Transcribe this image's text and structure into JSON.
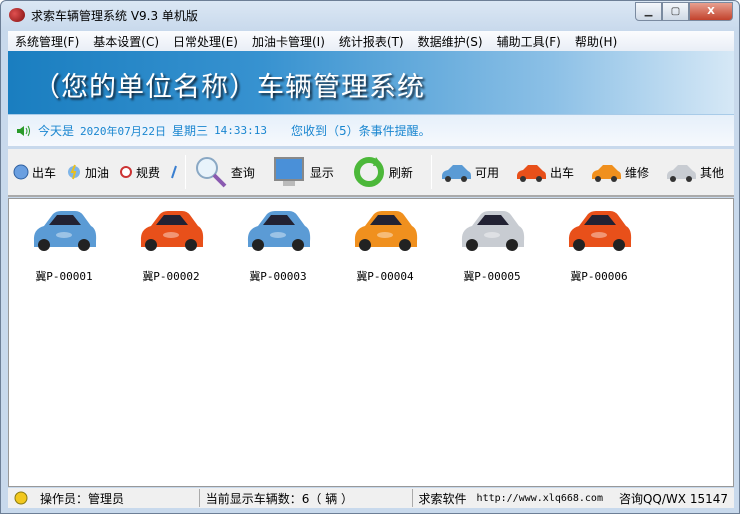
{
  "window": {
    "title": "求索车辆管理系统 V9.3 单机版"
  },
  "menu": [
    "系统管理(F)",
    "基本设置(C)",
    "日常处理(E)",
    "加油卡管理(I)",
    "统计报表(T)",
    "数据维护(S)",
    "辅助工具(F)",
    "帮助(H)"
  ],
  "banner": {
    "title": "（您的单位名称）车辆管理系统"
  },
  "info": {
    "today_label": "今天是",
    "date": "2020年07月22日",
    "weekday": "星期三",
    "time": "14:33:13",
    "reminder": "您收到（5）条事件提醒。"
  },
  "toolbar": {
    "depart": "出车",
    "refuel": "加油",
    "fees": "规费",
    "query": "查询",
    "display": "显示",
    "refresh": "刷新",
    "available": "可用",
    "out": "出车",
    "repair": "维修",
    "other": "其他"
  },
  "colors": {
    "available": "#5b9bd5",
    "out": "#e8501a",
    "repair": "#f0901e",
    "other": "#c8ccd2"
  },
  "vehicles": [
    {
      "plate": "冀P-00001",
      "color": "#5b9bd5"
    },
    {
      "plate": "冀P-00002",
      "color": "#e8501a"
    },
    {
      "plate": "冀P-00003",
      "color": "#5b9bd5"
    },
    {
      "plate": "冀P-00004",
      "color": "#f0901e"
    },
    {
      "plate": "冀P-00005",
      "color": "#c8ccd2"
    },
    {
      "plate": "冀P-00006",
      "color": "#e8501a"
    }
  ],
  "status": {
    "operator": "操作员：管理员",
    "count": "当前显示车辆数：6（ 辆 ）",
    "company": "求索软件",
    "url": "http://www.xlq668.com",
    "contact": "咨询QQ/WX 15147"
  }
}
